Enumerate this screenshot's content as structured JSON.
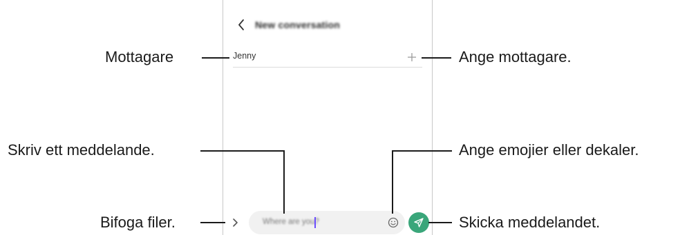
{
  "app": {
    "title": "New conversation",
    "recipient": "Jenny",
    "message_placeholder": "Where are you?"
  },
  "callouts": {
    "recipient": "Mottagare",
    "add_recipient": "Ange mottagare.",
    "write_message": "Skriv ett meddelande.",
    "emoji_stickers": "Ange emojier eller dekaler.",
    "attach_files": "Bifoga filer.",
    "send_message": "Skicka meddelandet."
  },
  "icons": {
    "back": "back-arrow-icon",
    "add": "plus-icon",
    "attach": "chevron-right-icon",
    "emoji": "emoji-icon",
    "send": "send-icon"
  },
  "colors": {
    "send_button": "#3aa67a",
    "cursor": "#6a4cff",
    "field_bg": "#f1f1f1"
  }
}
